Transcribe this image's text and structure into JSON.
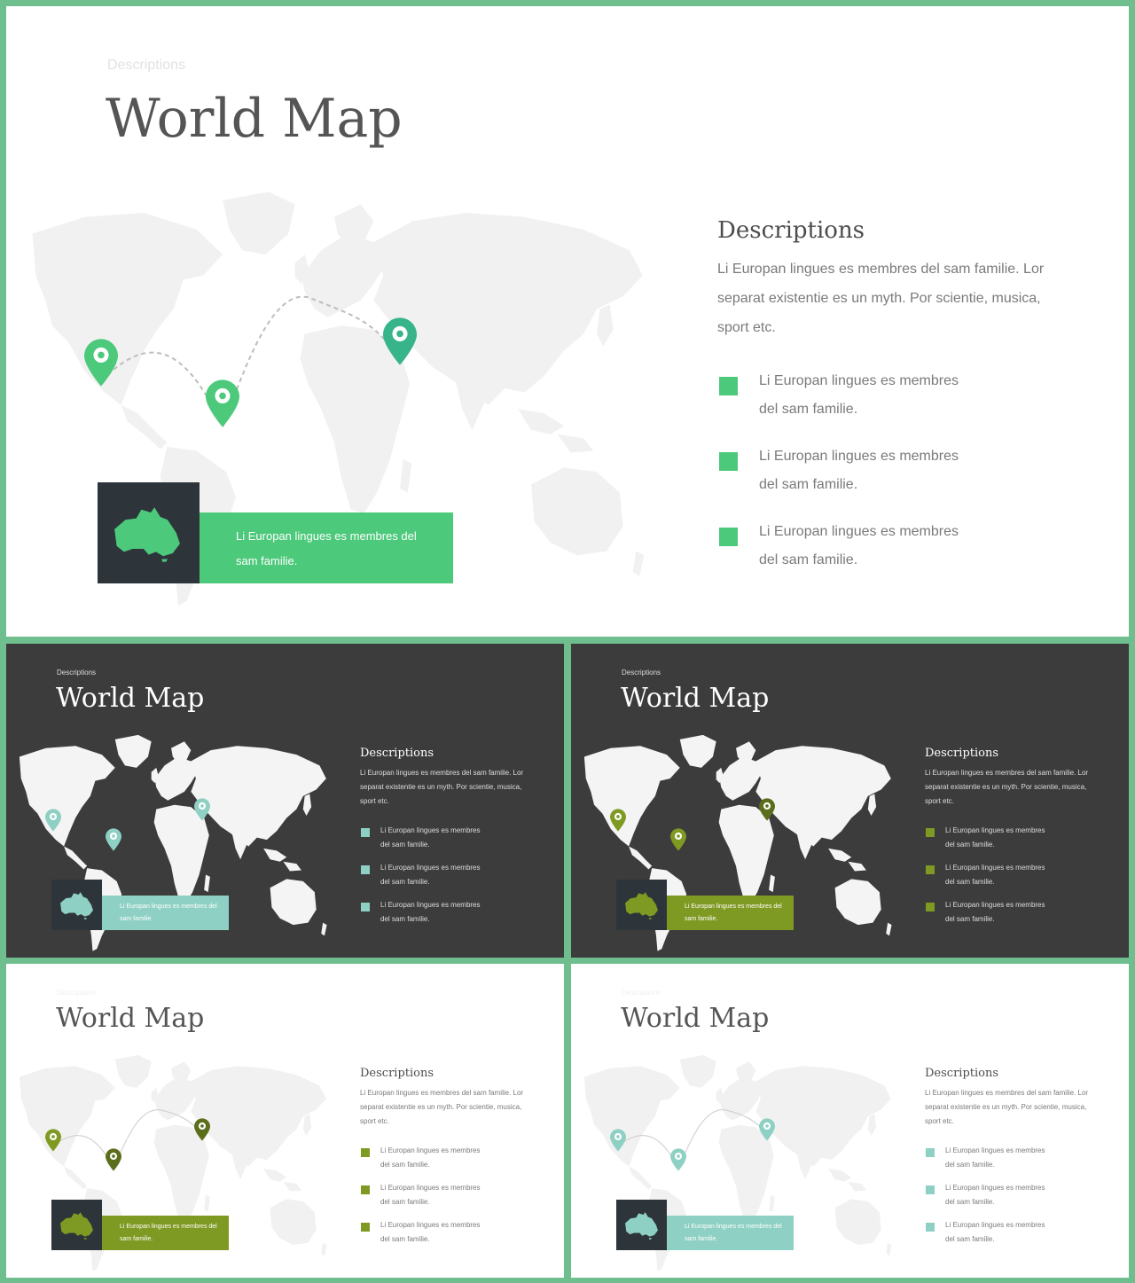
{
  "colors": {
    "frame": "#6fbf8e",
    "green": "#4cc97a",
    "green_dark": "#38b48a",
    "teal": "#8fd0c4",
    "olive": "#7f9a22",
    "olive_dark": "#5b6e1b",
    "callout_box": "#2e353a",
    "dark_bg": "#3c3c3c",
    "map_light": "#f1f1f1",
    "map_dark": "#f4f4f4"
  },
  "slides": [
    {
      "kicker": "Descriptions",
      "title": "World Map",
      "heading": "Descriptions",
      "paragraph": "Li Europan lingues es membres del sam familie. Lor separat existentie es un myth. Por scientie, musica, sport etc.",
      "bullets": [
        {
          "line1": "Li Europan lingues es membres",
          "line2": "del sam familie."
        },
        {
          "line1": "Li Europan lingues es membres",
          "line2": "del sam familie."
        },
        {
          "line1": "Li Europan lingues es membres",
          "line2": "del sam familie."
        }
      ],
      "callout": "Li Europan lingues es membres del sam familie.",
      "icon": "australia-icon",
      "pin_icon": "location-pin-icon"
    },
    {
      "kicker": "Descriptions",
      "title": "World Map",
      "heading": "Descriptions",
      "paragraph": "Li Europan lingues es membres del sam familie. Lor separat existentie es un myth. Por scientie, musica, sport etc.",
      "bullets": [
        {
          "line1": "Li Europan lingues es membres",
          "line2": "del sam familie."
        },
        {
          "line1": "Li Europan lingues es membres",
          "line2": "del sam familie."
        },
        {
          "line1": "Li Europan lingues es membres",
          "line2": "del sam familie."
        }
      ],
      "callout": "Li Europan lingues es membres del sam familie."
    },
    {
      "kicker": "Descriptions",
      "title": "World Map",
      "heading": "Descriptions",
      "paragraph": "Li Europan lingues es membres del sam familie. Lor separat existentie es un myth. Por scientie, musica, sport etc.",
      "bullets": [
        {
          "line1": "Li Europan lingues es membres",
          "line2": "del sam familie."
        },
        {
          "line1": "Li Europan lingues es membres",
          "line2": "del sam familie."
        },
        {
          "line1": "Li Europan lingues es membres",
          "line2": "del sam familie."
        }
      ],
      "callout": "Li Europan lingues es membres del sam familie."
    },
    {
      "kicker": "Descriptions",
      "title": "World Map",
      "heading": "Descriptions",
      "paragraph": "Li Europan lingues es membres del sam familie. Lor separat existentie es un myth. Por scientie, musica, sport etc.",
      "bullets": [
        {
          "line1": "Li Europan lingues es membres",
          "line2": "del sam familie."
        },
        {
          "line1": "Li Europan lingues es membres",
          "line2": "del sam familie."
        },
        {
          "line1": "Li Europan lingues es membres",
          "line2": "del sam familie."
        }
      ],
      "callout": "Li Europan lingues es membres del sam familie."
    },
    {
      "kicker": "Descriptions",
      "title": "World Map",
      "heading": "Descriptions",
      "paragraph": "Li Europan lingues es membres del sam familie. Lor separat existentie es un myth. Por scientie, musica, sport etc.",
      "bullets": [
        {
          "line1": "Li Europan lingues es membres",
          "line2": "del sam familie."
        },
        {
          "line1": "Li Europan lingues es membres",
          "line2": "del sam familie."
        },
        {
          "line1": "Li Europan lingues es membres",
          "line2": "del sam familie."
        }
      ],
      "callout": "Li Europan lingues es membres del sam familie."
    }
  ]
}
